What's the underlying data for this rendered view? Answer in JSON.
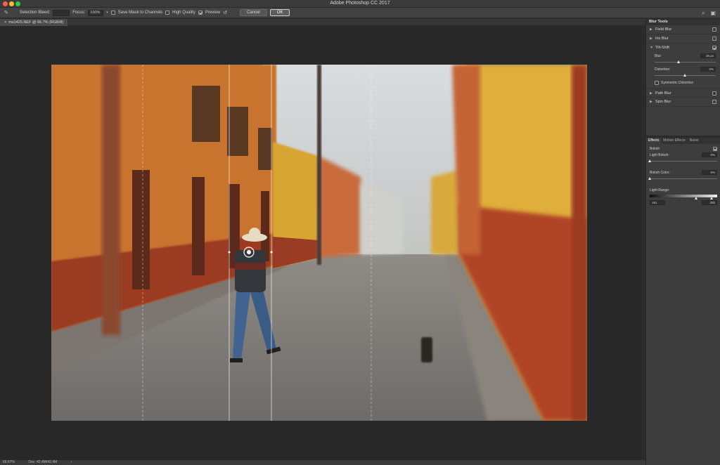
{
  "window": {
    "title": "Adobe Photoshop CC 2017"
  },
  "options_bar": {
    "selection_bleed_label": "Selection Bleed:",
    "selection_bleed_value": "",
    "focus_label": "Focus:",
    "focus_value": "100%",
    "save_mask_label": "Save Mask to Channels",
    "save_mask_checked": false,
    "high_quality_label": "High Quality",
    "high_quality_checked": false,
    "preview_label": "Preview",
    "preview_checked": true,
    "cancel_label": "Cancel",
    "ok_label": "OK"
  },
  "document": {
    "tab_title": "ms1425.NEF @ 66.7% (RGB/8)"
  },
  "status_bar": {
    "zoom": "66.67%",
    "doc_size": "Doc: 42.4M/42.4M"
  },
  "blur_tools": {
    "header": "Blur Tools",
    "items": [
      {
        "label": "Field Blur",
        "checked": false,
        "expanded": false
      },
      {
        "label": "Iris Blur",
        "checked": false,
        "expanded": false
      },
      {
        "label": "Tilt-Shift",
        "checked": true,
        "expanded": true
      },
      {
        "label": "Path Blur",
        "checked": false,
        "expanded": false
      },
      {
        "label": "Spin Blur",
        "checked": false,
        "expanded": false
      }
    ],
    "tilt_shift": {
      "blur_label": "Blur:",
      "blur_value": "36 px",
      "blur_pct": 0.4,
      "distortion_label": "Distortion:",
      "distortion_value": "0%",
      "distortion_pct": 0.5,
      "symmetric_label": "Symmetric Distortion",
      "symmetric_checked": false
    }
  },
  "effects": {
    "tabs": [
      "Effects",
      "Motion Effects",
      "Noise"
    ],
    "active_tab": 0,
    "bokeh_label": "Bokeh",
    "bokeh_checked": true,
    "light_bokeh_label": "Light Bokeh:",
    "light_bokeh_value": "0%",
    "light_bokeh_pct": 0.0,
    "bokeh_color_label": "Bokeh Color:",
    "bokeh_color_value": "0%",
    "bokeh_color_pct": 0.0,
    "light_range_label": "Light Range:",
    "light_range_low": "191",
    "light_range_high": "255"
  }
}
